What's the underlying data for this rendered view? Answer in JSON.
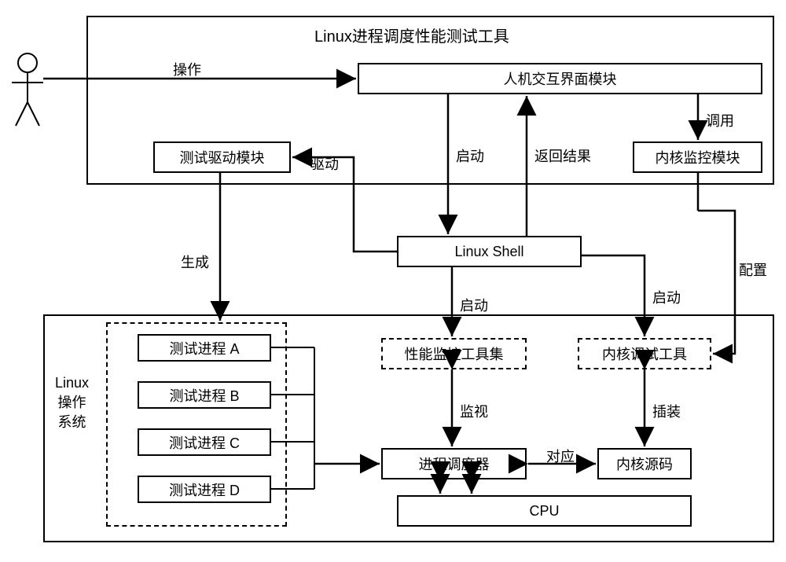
{
  "diagram": {
    "title_upper": "Linux进程调度性能测试工具",
    "ui_module": "人机交互界面模块",
    "test_driver": "测试驱动模块",
    "kernel_monitor": "内核监控模块",
    "linux_shell": "Linux Shell",
    "perf_tools": "性能监控工具集",
    "kernel_debug": "内核调试工具",
    "scheduler": "进程调度器",
    "kernel_source": "内核源码",
    "cpu": "CPU",
    "os_label": "Linux\n操作\n系统",
    "proc_a": "测试进程 A",
    "proc_b": "测试进程 B",
    "proc_c": "测试进程 C",
    "proc_d": "测试进程 D",
    "labels": {
      "operate": "操作",
      "call": "调用",
      "drive": "驱动",
      "startup": "启动",
      "return": "返回结果",
      "generate": "生成",
      "config": "配置",
      "startup2": "启动",
      "startup3": "启动",
      "monitor": "监视",
      "instrument": "插装",
      "correspond": "对应"
    }
  }
}
